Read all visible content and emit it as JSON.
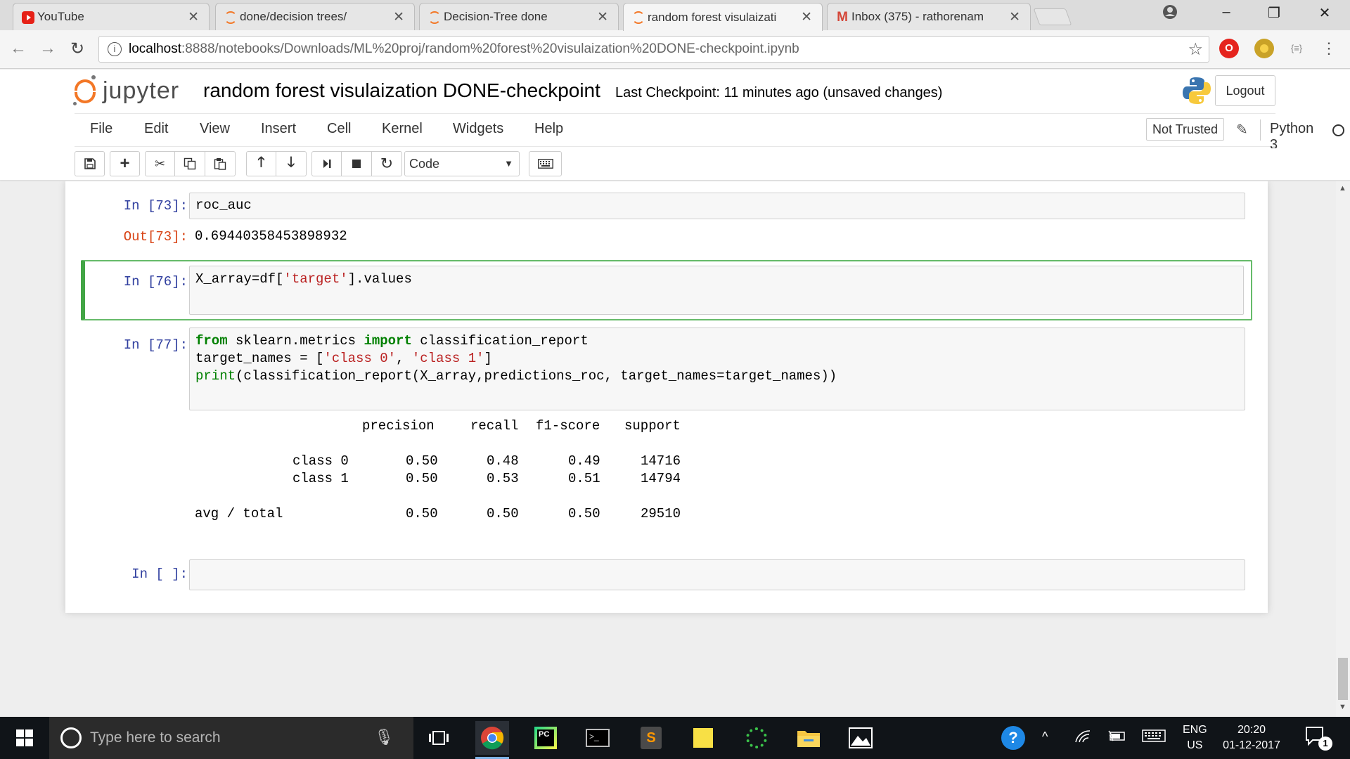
{
  "browser": {
    "tabs": [
      {
        "title": "YouTube",
        "icon": "youtube-icon"
      },
      {
        "title": "done/decision trees/",
        "icon": "jupyter-icon"
      },
      {
        "title": "Decision-Tree done",
        "icon": "jupyter-icon"
      },
      {
        "title": "random forest visulaizati",
        "icon": "jupyter-icon",
        "active": true
      },
      {
        "title": "Inbox (375) - rathorenam",
        "icon": "gmail-icon"
      }
    ],
    "url_host": "localhost",
    "url_path": ":8888/notebooks/Downloads/ML%20proj/random%20forest%20visulaization%20DONE-checkpoint.ipynb",
    "extension_badge": "{≡}"
  },
  "jupyter": {
    "logo_text": "jupyter",
    "notebook_title": "random forest visulaization DONE-checkpoint",
    "checkpoint_text": "Last Checkpoint: 11 minutes ago (unsaved changes)",
    "logout_label": "Logout",
    "menu": [
      "File",
      "Edit",
      "View",
      "Insert",
      "Cell",
      "Kernel",
      "Widgets",
      "Help"
    ],
    "not_trusted_label": "Not Trusted",
    "kernel_name": "Python 3",
    "cell_type": "Code"
  },
  "cells": [
    {
      "prompt": "In [73]:",
      "code": "roc_auc",
      "out_prompt": "Out[73]:",
      "output": "0.69440358453898932"
    },
    {
      "prompt": "In [76]:",
      "code_parts": [
        "X_array=df[",
        "'target'",
        "].values"
      ]
    },
    {
      "prompt": "In [77]:",
      "line1": [
        "from",
        " sklearn.metrics ",
        "import",
        " classification_report"
      ],
      "line2": [
        "target_names = [",
        "'class 0'",
        ", ",
        "'class 1'",
        "]"
      ],
      "line3": [
        "print",
        "(classification_report(X_array,predictions_roc, target_names=target_names))"
      ],
      "report_header": [
        "precision",
        "recall",
        "f1-score",
        "support"
      ],
      "report_rows": [
        {
          "label": "class 0",
          "precision": "0.50",
          "recall": "0.48",
          "f1": "0.49",
          "support": "14716"
        },
        {
          "label": "class 1",
          "precision": "0.50",
          "recall": "0.53",
          "f1": "0.51",
          "support": "14794"
        },
        {
          "label": "avg / total",
          "precision": "0.50",
          "recall": "0.50",
          "f1": "0.50",
          "support": "29510"
        }
      ]
    },
    {
      "prompt": "In [ ]:"
    }
  ],
  "taskbar": {
    "search_placeholder": "Type here to search",
    "lang_line1": "ENG",
    "lang_line2": "US",
    "time": "20:20",
    "date": "01-12-2017",
    "notification_count": "1"
  },
  "colors": {
    "jupyter_orange": "#f37726",
    "selected_cell_green": "#42a545",
    "in_prompt": "#303f9f",
    "out_prompt": "#d84315"
  }
}
